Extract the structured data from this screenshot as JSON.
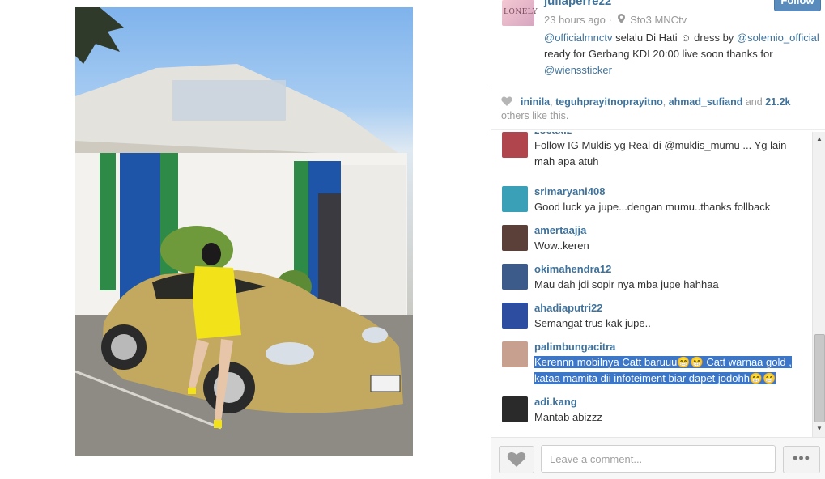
{
  "post": {
    "username": "juliaperrez2",
    "avatar_text": "LONELY",
    "follow_label": "Follow",
    "time_ago": "23 hours ago",
    "location": "Sto3 MNCtv",
    "caption": [
      {
        "text": "@officialmnctv",
        "mention": true
      },
      {
        "text": " selalu Di Hati ☺ dress by ",
        "mention": false
      },
      {
        "text": "@solemio_official",
        "mention": true
      },
      {
        "text": " ready for Gerbang KDI 20:00 live soon thanks for ",
        "mention": false
      },
      {
        "text": "@wienssticker",
        "mention": true
      }
    ]
  },
  "likes": {
    "users": [
      "ininila",
      "teguhprayitnoprayitno",
      "ahmad_sufiand"
    ],
    "and_text": "and",
    "count": "21.2k",
    "suffix": "others like this."
  },
  "comments": [
    {
      "user": "zoeaxiz",
      "text": "Follow IG Muklis yg Real di @muklis_mumu ... Yg lain mah apa atuh",
      "highlight": false,
      "avatar_color": "#b0454e"
    },
    {
      "user": "srimaryani408",
      "text": "Good luck ya jupe...dengan mumu..thanks follback",
      "highlight": false,
      "avatar_color": "#3aa0b8"
    },
    {
      "user": "amertaajja",
      "text": "Wow..keren",
      "highlight": false,
      "avatar_color": "#5a4038"
    },
    {
      "user": "okimahendra12",
      "text": "Mau dah jdi sopir nya mba jupe hahhaa",
      "highlight": false,
      "avatar_color": "#3c5a8a"
    },
    {
      "user": "ahadiaputri22",
      "text": "Semangat trus kak jupe..",
      "highlight": false,
      "avatar_color": "#2d4ea0"
    },
    {
      "user": "palimbungacitra",
      "text": "Kerennn mobilnya Catt baruuu😁😁 Catt warnaa gold , kataa mamita dii infoteiment biar dapet jodohh😁😁",
      "highlight": true,
      "avatar_color": "#c8a090"
    },
    {
      "user": "adi.kang",
      "text": "Mantab abizzz",
      "highlight": false,
      "avatar_color": "#2a2a2a"
    }
  ],
  "comment_box": {
    "placeholder": "Leave a comment...",
    "more_label": "•••"
  },
  "colors": {
    "link": "#3f729b",
    "highlight": "#3b76c9"
  },
  "icons": {
    "like": "heart-icon",
    "location": "location-pin-icon",
    "scroll_up": "scroll-up-arrow-icon",
    "scroll_down": "scroll-down-arrow-icon"
  }
}
